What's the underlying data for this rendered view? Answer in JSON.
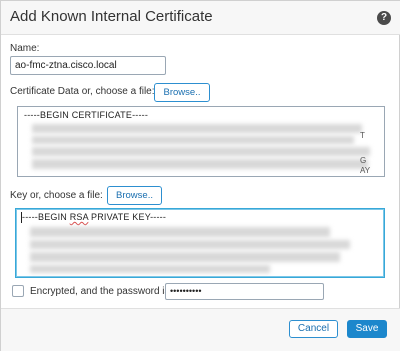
{
  "dialog": {
    "title": "Add Known Internal Certificate",
    "help_icon": "help-circle-icon"
  },
  "form": {
    "name_label": "Name:",
    "name_value": "ao-fmc-ztna.cisco.local",
    "cert_label": "Certificate Data or, choose a file:",
    "cert_browse_label": "Browse..",
    "cert_first_line": "-----BEGIN CERTIFICATE-----",
    "key_label": "Key or, choose a file:",
    "key_browse_label": "Browse..",
    "key_first_line_prefix": "-----BEGIN ",
    "key_first_line_rsa": "RSA",
    "key_first_line_suffix": " PRIVATE KEY-----",
    "encrypted_label": "Encrypted, and the password is:",
    "password_value": "••••••••••",
    "encrypted_checked": false
  },
  "footer": {
    "cancel_label": "Cancel",
    "save_label": "Save"
  },
  "colors": {
    "accent": "#1c87cc",
    "focus_border": "#38a8d8"
  }
}
